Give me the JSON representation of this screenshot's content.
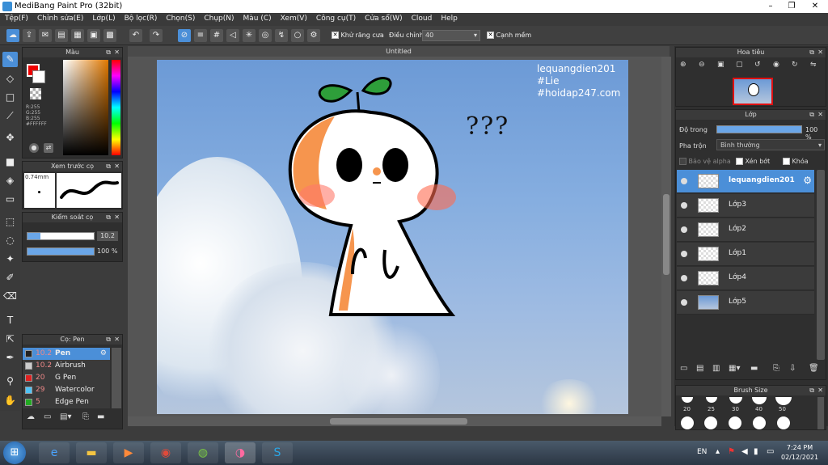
{
  "app": {
    "title": "MediBang Paint Pro (32bit)"
  },
  "menu": [
    "Tệp(F)",
    "Chỉnh sửa(E)",
    "Lớp(L)",
    "Bộ lọc(R)",
    "Chọn(S)",
    "Chụp(N)",
    "Màu (C)",
    "Xem(V)",
    "Công cụ(T)",
    "Cửa sổ(W)",
    "Cloud",
    "Help"
  ],
  "toolbar": {
    "antialias_label": "Khử răng cưa",
    "adjust_label": "Điều chỉnh",
    "adjust_value": "40",
    "edge_label": "Cạnh mềm"
  },
  "color_panel": {
    "title": "Màu",
    "rgb": [
      "R:255",
      "G:255",
      "B:255"
    ],
    "hex": "#FFFFFF"
  },
  "preview_panel": {
    "title": "Xem trước cọ",
    "size": "0.74mm"
  },
  "control_panel": {
    "title": "Kiểm soát cọ",
    "size_value": "10.2",
    "opacity_value": "100 %"
  },
  "brush_panel": {
    "title": "Cọ: Pen",
    "brushes": [
      {
        "size": "10.2",
        "name": "Pen",
        "color": "#222222"
      },
      {
        "size": "10.2",
        "name": "Airbrush",
        "color": "#cccccc"
      },
      {
        "size": "20",
        "name": "G Pen",
        "color": "#e02020"
      },
      {
        "size": "29",
        "name": "Watercolor (Wet",
        "color": "#4fc3f7"
      },
      {
        "size": "5",
        "name": "Edge Pen",
        "color": "#22aa22"
      }
    ]
  },
  "canvas": {
    "tab": "Untitled",
    "watermark": [
      "lequangdien201",
      "#Lie",
      "#hoidap247.com"
    ],
    "question": "???"
  },
  "navigator": {
    "title": "Hoa tiêu"
  },
  "layer_panel": {
    "title": "Lớp",
    "opacity_label": "Độ trong",
    "opacity_value": "100 %",
    "blend_label": "Pha trộn",
    "blend_value": "Bình thường",
    "protect_alpha": "Bảo vệ alpha",
    "clipping": "Xén bớt",
    "lock": "Khóa",
    "layers": [
      {
        "name": "lequangdien201"
      },
      {
        "name": "Lớp3"
      },
      {
        "name": "Lớp2"
      },
      {
        "name": "Lớp1"
      },
      {
        "name": "Lớp4"
      },
      {
        "name": "Lớp5"
      }
    ]
  },
  "brush_size_panel": {
    "title": "Brush Size",
    "sizes": [
      "20",
      "25",
      "30",
      "40",
      "50"
    ]
  },
  "taskbar": {
    "lang": "EN",
    "time": "7:24 PM",
    "date": "02/12/2021"
  }
}
